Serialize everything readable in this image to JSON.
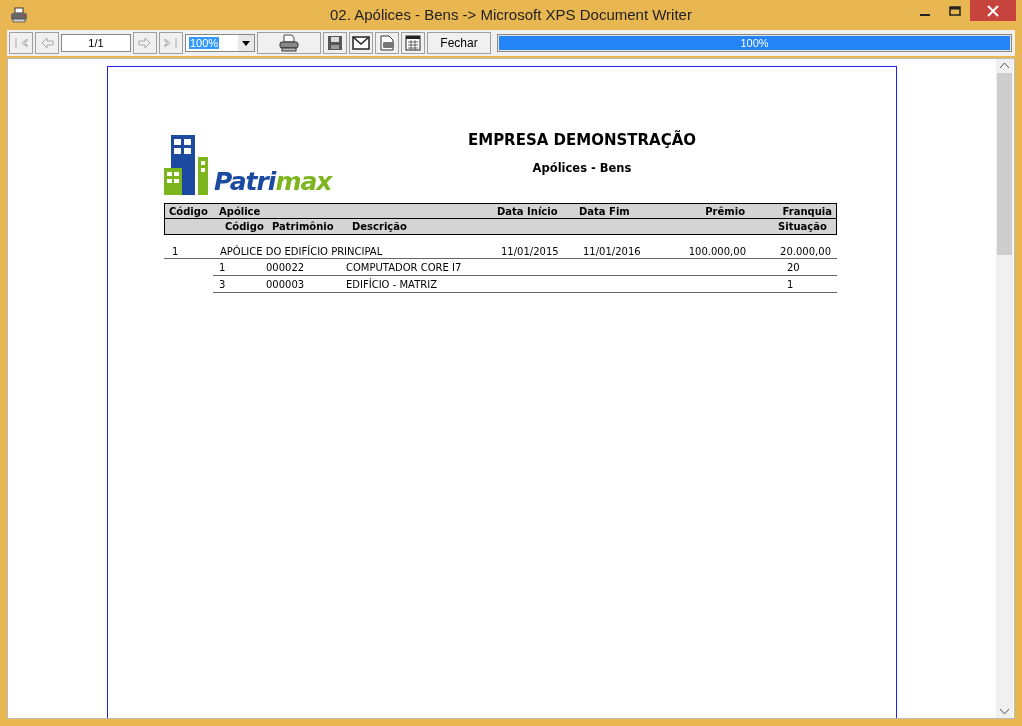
{
  "window": {
    "title": "02. Apólices - Bens -> Microsoft XPS Document Writer"
  },
  "toolbar": {
    "page": "1/1",
    "zoom": "100%",
    "close_button": "Fechar",
    "progress": {
      "level": 1.0,
      "reading": "100%"
    }
  },
  "report": {
    "logo": {
      "primary": "Patri",
      "accent": "max"
    },
    "company": "EMPRESA DEMONSTRAÇÃO",
    "title": "Apólices - Bens",
    "header_1": [
      "Código",
      "Apólice",
      "Data Início",
      "Data Fim",
      "Prêmio",
      "Franquia"
    ],
    "header_2": [
      "Código",
      "Patrimônio",
      "Descrição",
      "Situação"
    ],
    "policies": [
      {
        "cells": [
          "1",
          "APÓLICE DO EDIFÍCIO PRINCIPAL",
          "11/01/2015",
          "11/01/2016",
          "100.000,00",
          "20.000,00"
        ],
        "items": [
          [
            "1",
            "000022",
            "COMPUTADOR CORE I7",
            "20"
          ],
          [
            "3",
            "000003",
            "EDIFÍCIO - MATRIZ",
            "1"
          ]
        ]
      }
    ]
  }
}
